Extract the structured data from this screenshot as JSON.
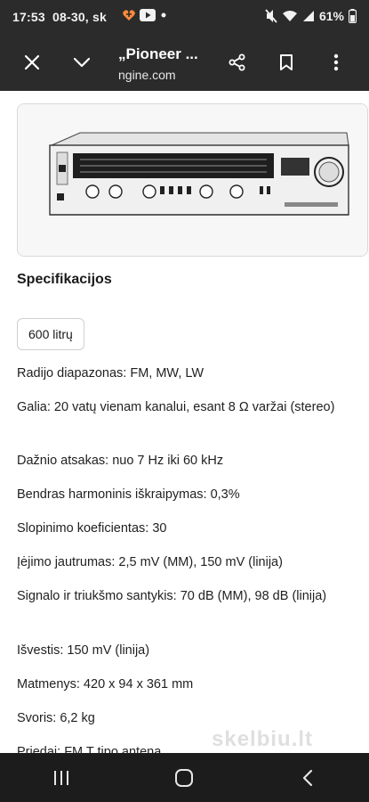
{
  "status_bar": {
    "time": "17:53",
    "date": "08-30, sk",
    "battery": "61%",
    "icons": [
      "sparkle-heart-icon",
      "youtube-icon",
      "dot-icon",
      "mute-icon",
      "wifi-icon",
      "signal-icon",
      "battery-icon"
    ]
  },
  "app_bar": {
    "title": "„Pioneer ...",
    "url": "ngine.com",
    "icons": [
      "close-icon",
      "chevron-down-icon",
      "share-icon",
      "bookmark-icon",
      "more-vert-icon"
    ]
  },
  "listing": {
    "section_title": "Specifikacijos",
    "chip_label": "600 litrų",
    "specs": [
      "Radijo diapazonas: FM, MW, LW",
      "Galia: 20 vatų vienam kanalui, esant 8 Ω varžai (stereo)",
      "Dažnio atsakas: nuo 7 Hz iki 60 kHz",
      "Bendras harmoninis iškraipymas: 0,3%",
      "Slopinimo koeficientas: 30",
      "Įėjimo jautrumas: 2,5 mV (MM), 150 mV (linija)",
      "Signalo ir triukšmo santykis: 70 dB (MM), 98 dB (linija)",
      "Išvestis: 150 mV (linija)",
      "Matmenys: 420 x 94 x 361 mm",
      "Svoris: 6,2 kg",
      "Priedai: FM T tipo antena"
    ],
    "watermark": "skelbiu.lt"
  },
  "nav_bar": {
    "icons": [
      "recent-apps-icon",
      "home-icon",
      "back-icon"
    ]
  }
}
